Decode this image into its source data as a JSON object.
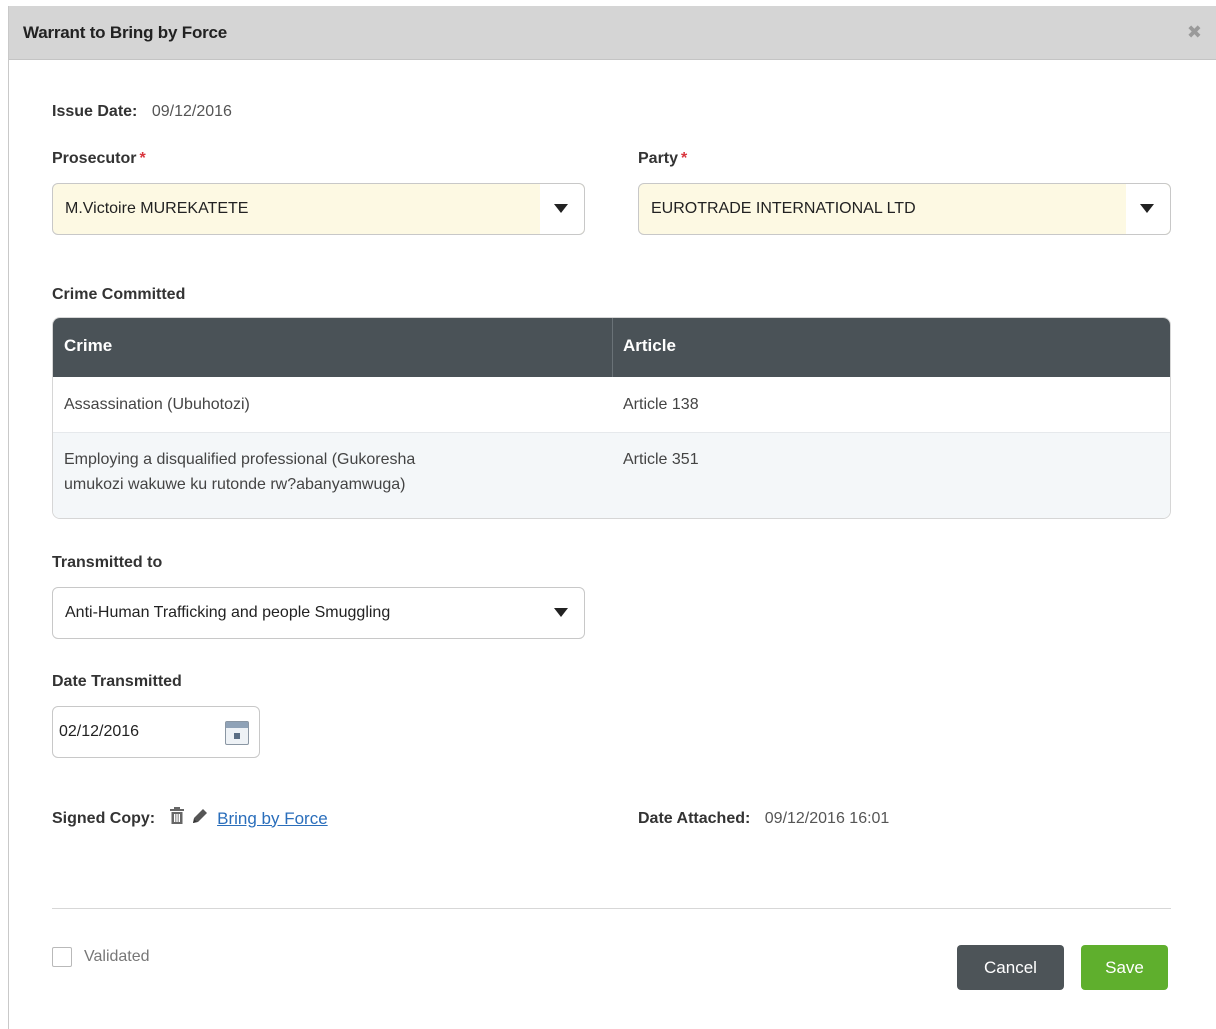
{
  "dialog": {
    "title": "Warrant to Bring by Force",
    "close_icon": "close-x-icon"
  },
  "issue": {
    "label": "Issue Date:",
    "value": "09/12/2016"
  },
  "prosecutor": {
    "label": "Prosecutor",
    "required_mark": "*",
    "value": "M.Victoire MUREKATETE"
  },
  "party": {
    "label": "Party",
    "required_mark": "*",
    "value": "EUROTRADE INTERNATIONAL LTD"
  },
  "crime_section": {
    "label": "Crime Committed",
    "columns": [
      "Crime",
      "Article"
    ],
    "rows": [
      {
        "crime": "Assassination (Ubuhotozi)",
        "article": "Article 138"
      },
      {
        "crime_line1": "Employing a disqualified professional (Gukoresha",
        "crime_line2": "umukozi wakuwe ku rutonde rw?abanyamwuga)",
        "article": "Article 351"
      }
    ]
  },
  "transmitted": {
    "label": "Transmitted to",
    "value": "Anti-Human Trafficking and people Smuggling"
  },
  "date_transmitted": {
    "label": "Date Transmitted",
    "value": "02/12/2016",
    "icon": "calendar-icon"
  },
  "signed_copy": {
    "label": "Signed Copy:",
    "link": "Bring by Force",
    "icons": [
      "trash-icon",
      "pencil-icon"
    ]
  },
  "date_attached": {
    "label": "Date Attached:",
    "value": "09/12/2016 16:01"
  },
  "footer": {
    "validated_label": "Validated",
    "cancel_label": "Cancel",
    "save_label": "Save"
  },
  "colors": {
    "titlebar": "#d5d5d5",
    "grid_header": "#4a5257",
    "required": "#d9363e",
    "cancel": "#4d5458",
    "save": "#5faf2d",
    "link": "#2a6ebb",
    "select_highlight": "#fdf9e3"
  }
}
